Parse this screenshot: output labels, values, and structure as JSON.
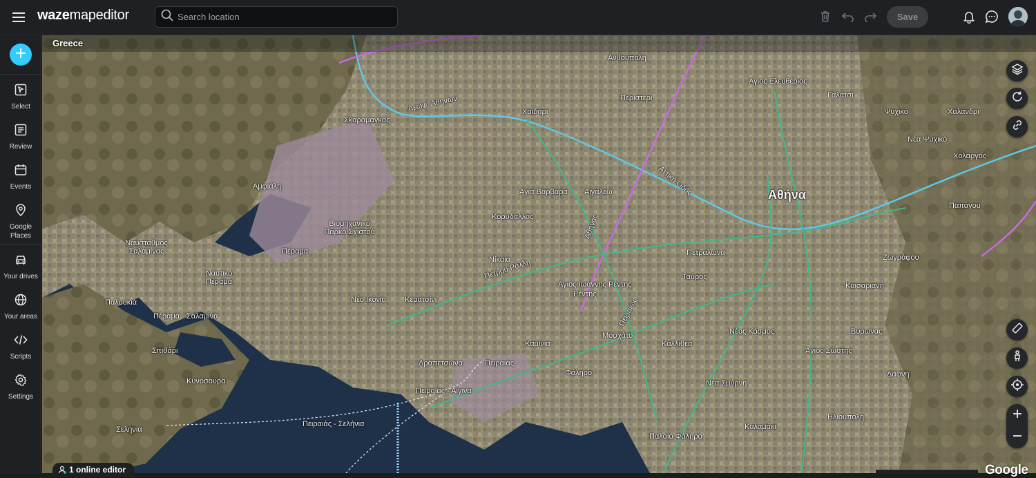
{
  "app": {
    "logo_bold": "waze",
    "logo_rest": "mapeditor"
  },
  "search": {
    "placeholder": "Search location"
  },
  "toolbar": {
    "icons": [
      "trash-icon",
      "undo-icon",
      "redo-icon"
    ],
    "save_label": "Save",
    "right_icons": [
      "bell-icon",
      "chat-icon"
    ]
  },
  "sidebar": {
    "add_icon": "plus-icon",
    "items": [
      {
        "label": "Select",
        "icon": "select-icon"
      },
      {
        "label": "Review",
        "icon": "review-icon"
      },
      {
        "label": "Events",
        "icon": "calendar-icon"
      },
      {
        "label": "Google Places",
        "icon": "map-pin-icon"
      },
      {
        "label": "Your drives",
        "icon": "car-icon"
      },
      {
        "label": "Your areas",
        "icon": "globe-icon"
      },
      {
        "label": "Scripts",
        "icon": "code-icon"
      },
      {
        "label": "Settings",
        "icon": "gear-icon"
      }
    ]
  },
  "map": {
    "country": "Greece",
    "labels": [
      {
        "text": "Αθήνα",
        "big": true
      },
      {
        "text": "Σκαραμαγκάς"
      },
      {
        "text": "Αμφιάλη"
      },
      {
        "text": "Βιομηχανικό Πάρκο Σχιστού"
      },
      {
        "text": "Πέραμα"
      },
      {
        "text": "Ναυτικό Πέραμα"
      },
      {
        "text": "Ναύσταθμος Σαλαμίνας"
      },
      {
        "text": "Παλουκιά"
      },
      {
        "text": "Πέραμα - Σαλαμίνα"
      },
      {
        "text": "Σεληνια"
      },
      {
        "text": "Κυνόσουρα"
      },
      {
        "text": "Σπιθάρι"
      },
      {
        "text": "Νίκαια"
      },
      {
        "text": "Κορυδαλλός"
      },
      {
        "text": "Αγία Βαρβάρα"
      },
      {
        "text": "Αιγάλεω"
      },
      {
        "text": "Χαϊδάρι"
      },
      {
        "text": "Περιστέρι"
      },
      {
        "text": "Ανθούπολη"
      },
      {
        "text": "Άγιος Ελευθέριος"
      },
      {
        "text": "Ρέντης"
      },
      {
        "text": "Άγιος Ιωάννης Ρέντης"
      },
      {
        "text": "Νέο Ικόνιο"
      },
      {
        "text": "Κερατσίνι"
      },
      {
        "text": "Δραπετσώνα"
      },
      {
        "text": "Πειραιάς"
      },
      {
        "text": "Καμίνια"
      },
      {
        "text": "Μοσχάτο"
      },
      {
        "text": "Καλλιθέα"
      },
      {
        "text": "Νέα Σμύρνη"
      },
      {
        "text": "Παλαιό Φάληρο"
      },
      {
        "text": "Ταύρος"
      },
      {
        "text": "Πειραιάς - Σελήνια"
      },
      {
        "text": "Πειραιάς - Αίγινα"
      },
      {
        "text": "Φάληρο"
      },
      {
        "text": "Καισαριανή"
      },
      {
        "text": "Βύρωνας"
      },
      {
        "text": "Ζωγράφου"
      },
      {
        "text": "Γαλάτσι"
      },
      {
        "text": "Χαλάνδρι"
      },
      {
        "text": "Ψυχικό"
      },
      {
        "text": "Νέα Ψυχικό"
      },
      {
        "text": "Παπάγου"
      },
      {
        "text": "Χολαργός"
      },
      {
        "text": "Ηλιούπολη"
      },
      {
        "text": "Δάφνη"
      },
      {
        "text": "Νέος Κόσμος"
      },
      {
        "text": "Πετράλωνα"
      },
      {
        "text": "Άγιος Σώστης"
      },
      {
        "text": "Καλαμάκι"
      },
      {
        "text": "Λεωφ. Αθηνών"
      },
      {
        "text": "Πέτρου Ράλλη"
      },
      {
        "text": "Αθηνάς"
      },
      {
        "text": "Αττική Οδός"
      },
      {
        "text": "Πειραιώς"
      }
    ]
  },
  "right_controls": [
    "layers-icon",
    "refresh-icon",
    "link-icon",
    "ruler-icon",
    "street-view-icon",
    "locate-icon"
  ],
  "zoom": {
    "in_icon": "zoom-in-icon",
    "out_icon": "zoom-out-icon"
  },
  "footer": {
    "online_editors": "1 online editor",
    "attribution": "Google"
  }
}
